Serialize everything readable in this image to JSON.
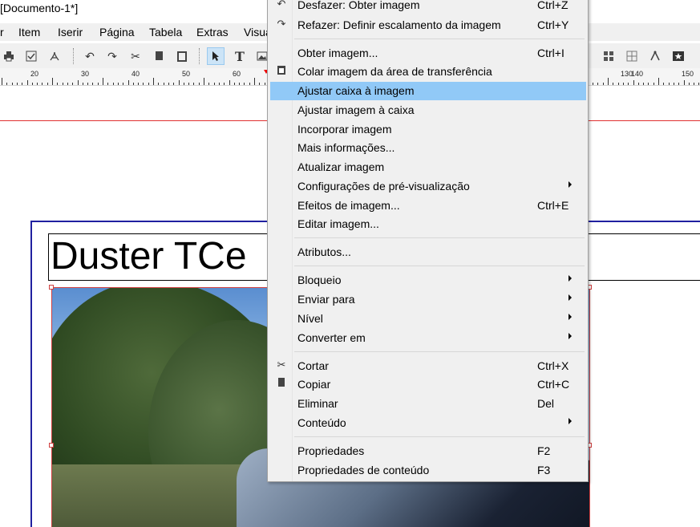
{
  "window": {
    "title": "[Documento-1*]"
  },
  "menubar": {
    "items": [
      "r",
      "Item",
      "Iserir",
      "Página",
      "Tabela",
      "Extras",
      "Visua"
    ]
  },
  "toolbar": {
    "left_icons": [
      "printer-icon",
      "checkbox-icon",
      "pdf-icon",
      "undo-icon",
      "redo-icon",
      "cut-icon",
      "copy-icon",
      "paste-icon",
      "select-arrow-icon",
      "text-tool-icon",
      "image-tool-icon"
    ],
    "right_icons": [
      "grid-a-icon",
      "grid-b-icon",
      "grid-c-icon",
      "measure-icon",
      "star-frame-icon"
    ]
  },
  "ruler": {
    "labels": [
      "20",
      "30",
      "40",
      "50",
      "60",
      "130",
      "140",
      "150"
    ]
  },
  "document": {
    "heading": "Duster TCe"
  },
  "context_menu": {
    "items": [
      {
        "label": "Desfazer: Obter imagem",
        "shortcut": "Ctrl+Z",
        "icon": "undo-icon"
      },
      {
        "label": "Refazer: Definir escalamento da imagem",
        "shortcut": "Ctrl+Y",
        "icon": "redo-icon"
      },
      {
        "label": "Obter imagem...",
        "shortcut": "Ctrl+I"
      },
      {
        "label": "Colar imagem da área de transferência",
        "icon": "paste-icon"
      },
      {
        "label": "Ajustar caixa à imagem"
      },
      {
        "label": "Ajustar imagem à caixa"
      },
      {
        "label": "Incorporar imagem"
      },
      {
        "label": "Mais informações..."
      },
      {
        "label": "Atualizar imagem"
      },
      {
        "label": "Configurações de pré-visualização"
      },
      {
        "label": "Efeitos de imagem...",
        "shortcut": "Ctrl+E"
      },
      {
        "label": "Editar imagem..."
      },
      {
        "label": "Atributos..."
      },
      {
        "label": "Bloqueio"
      },
      {
        "label": "Enviar para"
      },
      {
        "label": "Nível"
      },
      {
        "label": "Converter em"
      },
      {
        "label": "Cortar",
        "shortcut": "Ctrl+X",
        "icon": "cut-icon"
      },
      {
        "label": "Copiar",
        "shortcut": "Ctrl+C",
        "icon": "copy-icon"
      },
      {
        "label": "Eliminar",
        "shortcut": "Del"
      },
      {
        "label": "Conteúdo"
      },
      {
        "label": "Propriedades",
        "shortcut": "F2"
      },
      {
        "label": "Propriedades de conteúdo",
        "shortcut": "F3"
      }
    ],
    "highlighted": "Ajustar caixa à imagem",
    "highlight_color": "#91c9f7"
  }
}
